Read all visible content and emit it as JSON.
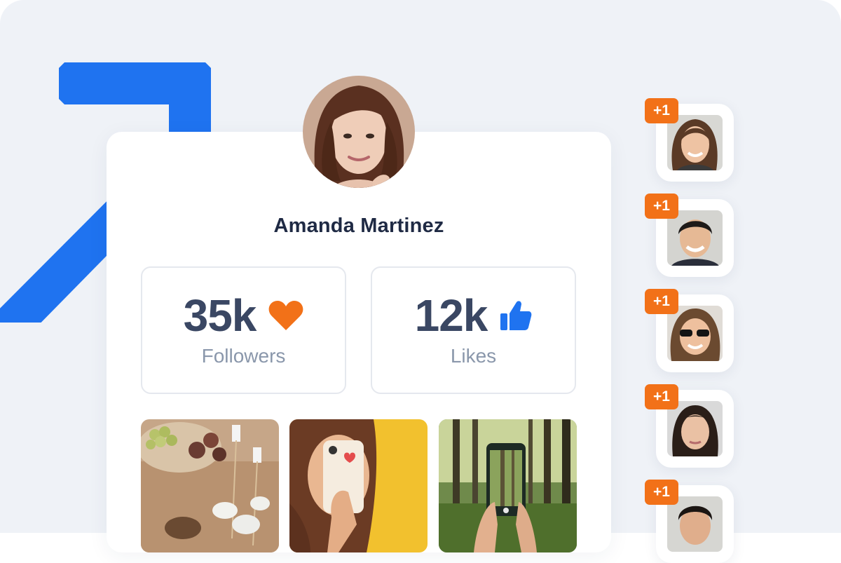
{
  "profile": {
    "name": "Amanda Martinez",
    "followers": {
      "value": "35k",
      "label": "Followers",
      "icon": "heart-icon",
      "icon_color": "#f27118"
    },
    "likes": {
      "value": "12k",
      "label": "Likes",
      "icon": "thumbs-up-icon",
      "icon_color": "#1f73f0"
    }
  },
  "reactions": [
    {
      "badge": "+1"
    },
    {
      "badge": "+1"
    },
    {
      "badge": "+1"
    },
    {
      "badge": "+1"
    },
    {
      "badge": "+1"
    }
  ],
  "colors": {
    "accent_blue": "#1f73f0",
    "accent_orange": "#f27118",
    "background": "#eff2f7",
    "name_text": "#1f2a44",
    "stat_text": "#3a4763",
    "label_text": "#8a97ab"
  }
}
